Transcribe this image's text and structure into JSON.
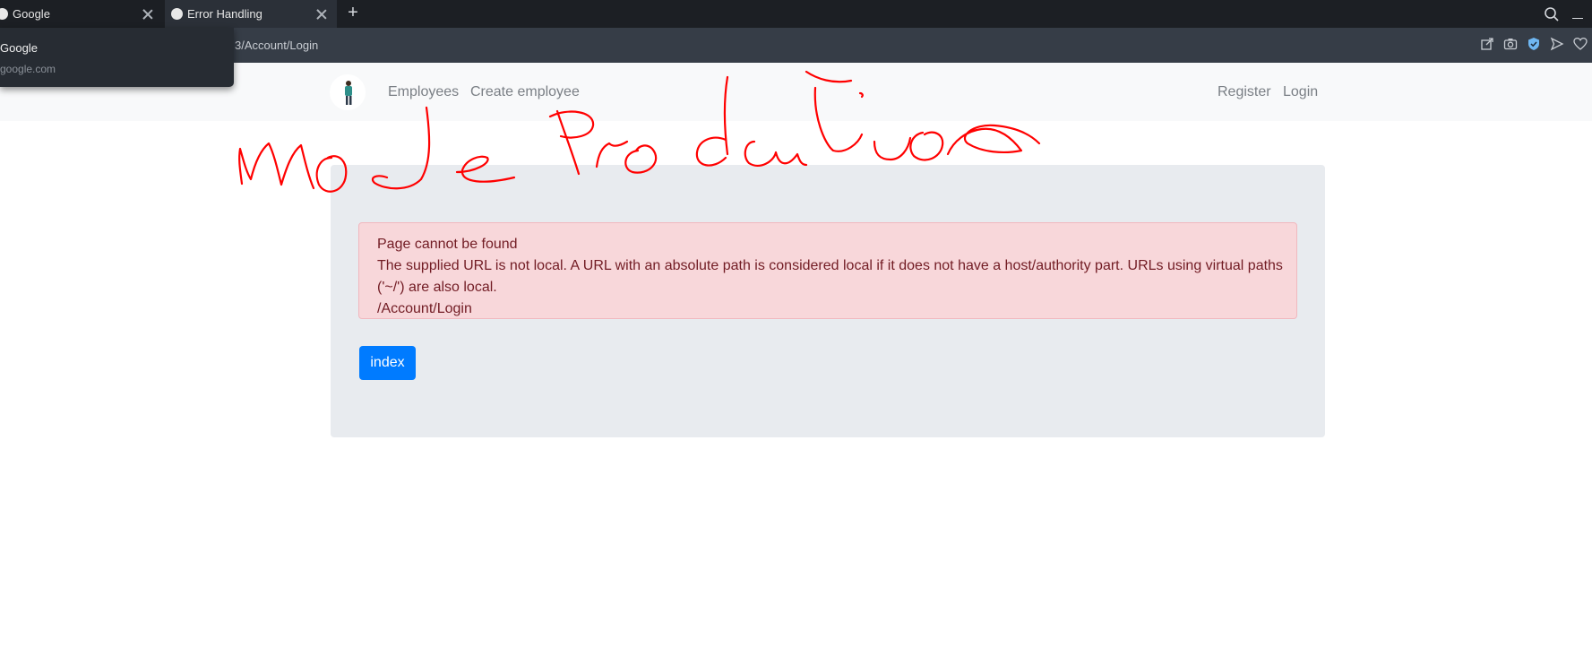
{
  "browser": {
    "tabs": [
      {
        "title": "Google",
        "active": false
      },
      {
        "title": "Error Handling",
        "active": true
      }
    ],
    "new_tab_label": "+",
    "address_text": "3/Account/Login",
    "suggestion": {
      "title": "Google",
      "url": "google.com"
    }
  },
  "navbar": {
    "links_left": [
      "Employees",
      "Create employee"
    ],
    "links_right": [
      "Register",
      "Login"
    ]
  },
  "error": {
    "heading": "Page cannot be found",
    "message_line1": "The supplied URL is not local. A URL with an absolute path is considered local if it does not have a host/authority part. URLs using virtual paths",
    "message_line2": "('~/') are also local.",
    "path": "/Account/Login"
  },
  "button": {
    "label": "index",
    "color": "#007bff"
  },
  "colors": {
    "alert_bg": "#f8d7da",
    "alert_text": "#721c24",
    "panel_bg": "#e8ebef",
    "annotation": "#ff0000"
  }
}
